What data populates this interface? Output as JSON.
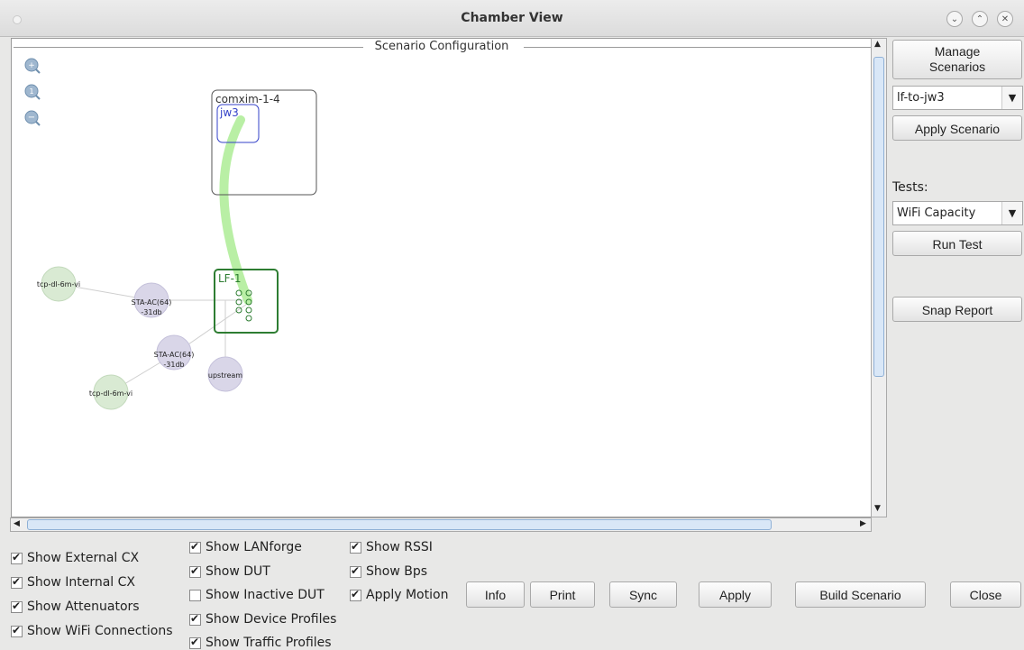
{
  "window": {
    "title": "Chamber View"
  },
  "panel": {
    "label": "Scenario Configuration"
  },
  "zoom_icons": [
    "zoom-in-icon",
    "zoom-reset-icon",
    "zoom-out-icon"
  ],
  "diagram": {
    "chamber": {
      "name": "comxim-1-4",
      "dut": "jw3"
    },
    "lanforge": {
      "name": "LF-1"
    },
    "nodes": [
      {
        "id": "traffic1",
        "label": "tcp-dl-6m-vi"
      },
      {
        "id": "sta1",
        "label": "STA-AC(64)",
        "sublabel": "-31db"
      },
      {
        "id": "sta2",
        "label": "STA-AC(64)",
        "sublabel": "-31db"
      },
      {
        "id": "traffic2",
        "label": "tcp-dl-6m-vi"
      },
      {
        "id": "upstream",
        "label": "upstream"
      }
    ],
    "colors": {
      "traffic": "#d9ead3",
      "station": "#d9d6e8",
      "link": "#b9efa5",
      "lanforge": "#2e7d32",
      "dut": "#3341c8"
    }
  },
  "side": {
    "manage_scenarios": [
      "Manage",
      "Scenarios"
    ],
    "scenario_select": "lf-to-jw3",
    "apply_scenario": "Apply Scenario",
    "tests_label": "Tests:",
    "tests_select": "WiFi Capacity",
    "run_test": "Run Test",
    "snap_report": "Snap Report"
  },
  "checkboxes": {
    "show_external_cx": {
      "label": "Show External CX",
      "checked": true
    },
    "show_internal_cx": {
      "label": "Show Internal CX",
      "checked": true
    },
    "show_attenuators": {
      "label": "Show Attenuators",
      "checked": true
    },
    "show_wifi_connections": {
      "label": "Show WiFi Connections",
      "checked": true
    },
    "show_lanforge": {
      "label": "Show LANforge",
      "checked": true
    },
    "show_dut": {
      "label": "Show DUT",
      "checked": true
    },
    "show_inactive_dut": {
      "label": "Show Inactive DUT",
      "checked": false
    },
    "show_device_profiles": {
      "label": "Show Device Profiles",
      "checked": true
    },
    "show_traffic_profiles": {
      "label": "Show Traffic Profiles",
      "checked": true
    },
    "show_rssi": {
      "label": "Show RSSI",
      "checked": true
    },
    "show_bps": {
      "label": "Show Bps",
      "checked": true
    },
    "apply_motion": {
      "label": "Apply Motion",
      "checked": true
    }
  },
  "buttons": {
    "info": "Info",
    "print": "Print",
    "sync": "Sync",
    "apply": "Apply",
    "build_scenario": "Build Scenario",
    "close": "Close"
  }
}
